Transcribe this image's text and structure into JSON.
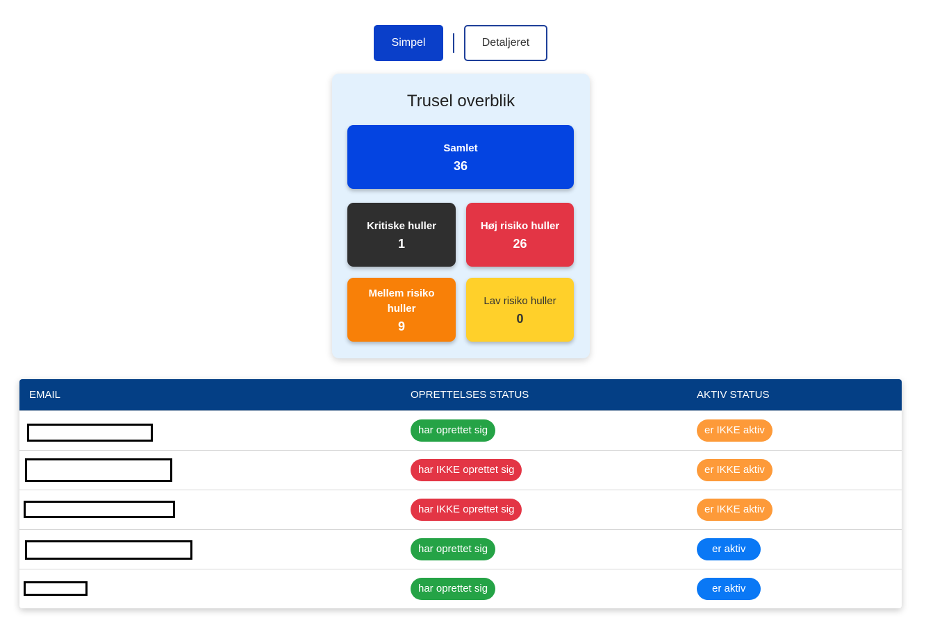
{
  "view_toggle": {
    "simple_label": "Simpel",
    "detailed_label": "Detaljeret"
  },
  "overview": {
    "title": "Trusel overblik",
    "total": {
      "label": "Samlet",
      "value": "36",
      "color": "#0444e1"
    },
    "critical": {
      "label": "Kritiske huller",
      "value": "1",
      "color": "#2f2f2f"
    },
    "high": {
      "label": "Høj risiko huller",
      "value": "26",
      "color": "#e33545"
    },
    "medium": {
      "label": "Mellem risiko huller",
      "value": "9",
      "color": "#f88008"
    },
    "low": {
      "label": "Lav risiko huller",
      "value": "0",
      "color": "#ffd02a"
    }
  },
  "table": {
    "headers": {
      "email": "EMAIL",
      "created": "OPRETTELSES STATUS",
      "active": "AKTIV STATUS"
    },
    "rows": [
      {
        "created": "har oprettet sig",
        "created_state": "yes",
        "active": "er IKKE aktiv",
        "active_state": "no"
      },
      {
        "created": "har IKKE oprettet sig",
        "created_state": "no",
        "active": "er IKKE aktiv",
        "active_state": "no"
      },
      {
        "created": "har IKKE oprettet sig",
        "created_state": "no",
        "active": "er IKKE aktiv",
        "active_state": "no"
      },
      {
        "created": "har oprettet sig",
        "created_state": "yes",
        "active": "er aktiv",
        "active_state": "yes"
      },
      {
        "created": "har oprettet sig",
        "created_state": "yes",
        "active": "er aktiv",
        "active_state": "yes"
      }
    ]
  },
  "colors": {
    "primary": "#0a3fc9",
    "header": "#043f85",
    "success": "#25a346",
    "danger": "#e33545",
    "warning": "#fd9a39",
    "info": "#0a78f5"
  }
}
